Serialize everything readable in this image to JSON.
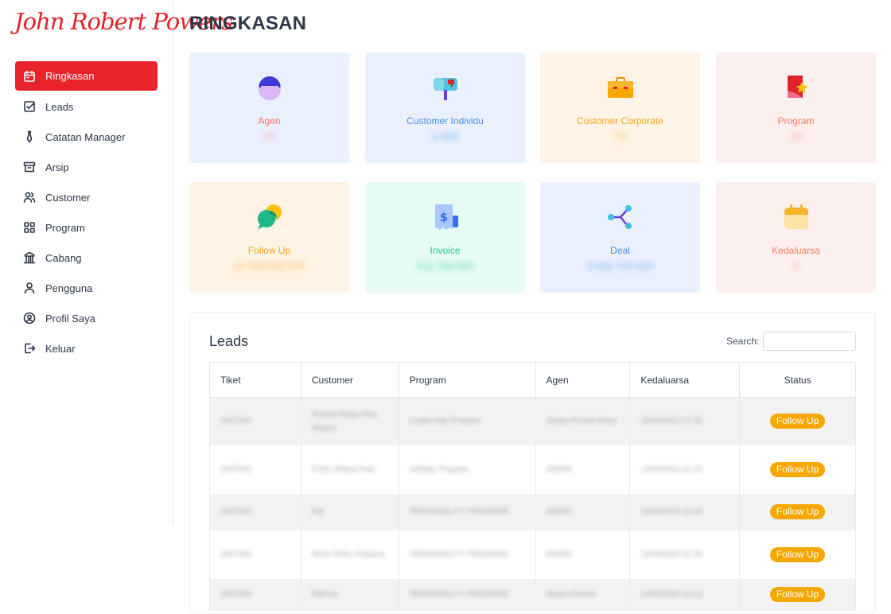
{
  "brand": {
    "logo_text": "John Robert Powers"
  },
  "sidebar": {
    "items": [
      {
        "label": "Ringkasan",
        "icon": "calendar-icon",
        "active": true
      },
      {
        "label": "Leads",
        "icon": "checkbox-icon"
      },
      {
        "label": "Catatan Manager",
        "icon": "tie-icon"
      },
      {
        "label": "Arsip",
        "icon": "archive-icon"
      },
      {
        "label": "Customer",
        "icon": "users-icon"
      },
      {
        "label": "Program",
        "icon": "grid-icon"
      },
      {
        "label": "Cabang",
        "icon": "building-icon"
      },
      {
        "label": "Pengguna",
        "icon": "user-icon"
      },
      {
        "label": "Profil Saya",
        "icon": "user-circle-icon"
      },
      {
        "label": "Keluar",
        "icon": "logout-icon"
      }
    ]
  },
  "page": {
    "title": "RINGKASAN"
  },
  "cards": [
    {
      "label": "Agen",
      "value": "15",
      "icon": "agent-avatar-icon",
      "bg": "#eaf0fd",
      "color": "#f07b5e"
    },
    {
      "label": "Customer Individu",
      "value": "2.403",
      "icon": "mailbox-icon",
      "bg": "#eaf0fd",
      "color": "#4a90e2"
    },
    {
      "label": "Customer Corporate",
      "value": "79",
      "icon": "briefcase-icon",
      "bg": "#fef3e4",
      "color": "#f5a623"
    },
    {
      "label": "Program",
      "value": "16",
      "icon": "flag-star-icon",
      "bg": "#fbf0ee",
      "color": "#f07b5e"
    },
    {
      "label": "Follow Up",
      "value": "42.348.935.000",
      "icon": "chat-bubbles-icon",
      "bg": "#fef3e4",
      "color": "#f5a623"
    },
    {
      "label": "Invoice",
      "value": "311.750.000",
      "icon": "receipt-icon",
      "bg": "#e5fbf3",
      "color": "#21c98b"
    },
    {
      "label": "Deal",
      "value": "3.958.705.000",
      "icon": "share-nodes-icon",
      "bg": "#eaf0fd",
      "color": "#4a90e2"
    },
    {
      "label": "Kedaluarsa",
      "value": "8",
      "icon": "calendar-color-icon",
      "bg": "#fbf0ee",
      "color": "#f07b5e"
    }
  ],
  "leads": {
    "title": "Leads",
    "search_label": "Search:",
    "search_value": "",
    "columns": [
      "Tiket",
      "Customer",
      "Program",
      "Agen",
      "Kedaluarsa",
      "Status"
    ],
    "rows": [
      {
        "tiket": "2307001",
        "customer": "Rachel Maya Dina Wijaya",
        "program": "Leadership Program",
        "agen": "Nadya Pertiwi Moyo",
        "kedaluarsa": "15/04/2023 17:36",
        "status": "Follow Up"
      },
      {
        "tiket": "2307002",
        "customer": "Fretty Afiana Putri",
        "program": "Holiday Program",
        "agen": "ADMIN",
        "kedaluarsa": "14/04/2023 11:01",
        "status": "Follow Up"
      },
      {
        "tiket": "2307003",
        "customer": "Nia",
        "program": "PERSONALITY PROGRAM",
        "agen": "ADMIN",
        "kedaluarsa": "14/04/2023 10:34",
        "status": "Follow Up"
      },
      {
        "tiket": "2307004",
        "customer": "Reno Rizky Pratama",
        "program": "PERSONALITY PROGRAM",
        "agen": "ADMIN",
        "kedaluarsa": "14/04/2023 11:00",
        "status": "Follow Up"
      },
      {
        "tiket": "2307005",
        "customer": "Rahma",
        "program": "PERSONALITY PROGRAM",
        "agen": "Nadya Pertiwi",
        "kedaluarsa": "14/04/2023 10:10",
        "status": "Follow Up"
      }
    ]
  }
}
